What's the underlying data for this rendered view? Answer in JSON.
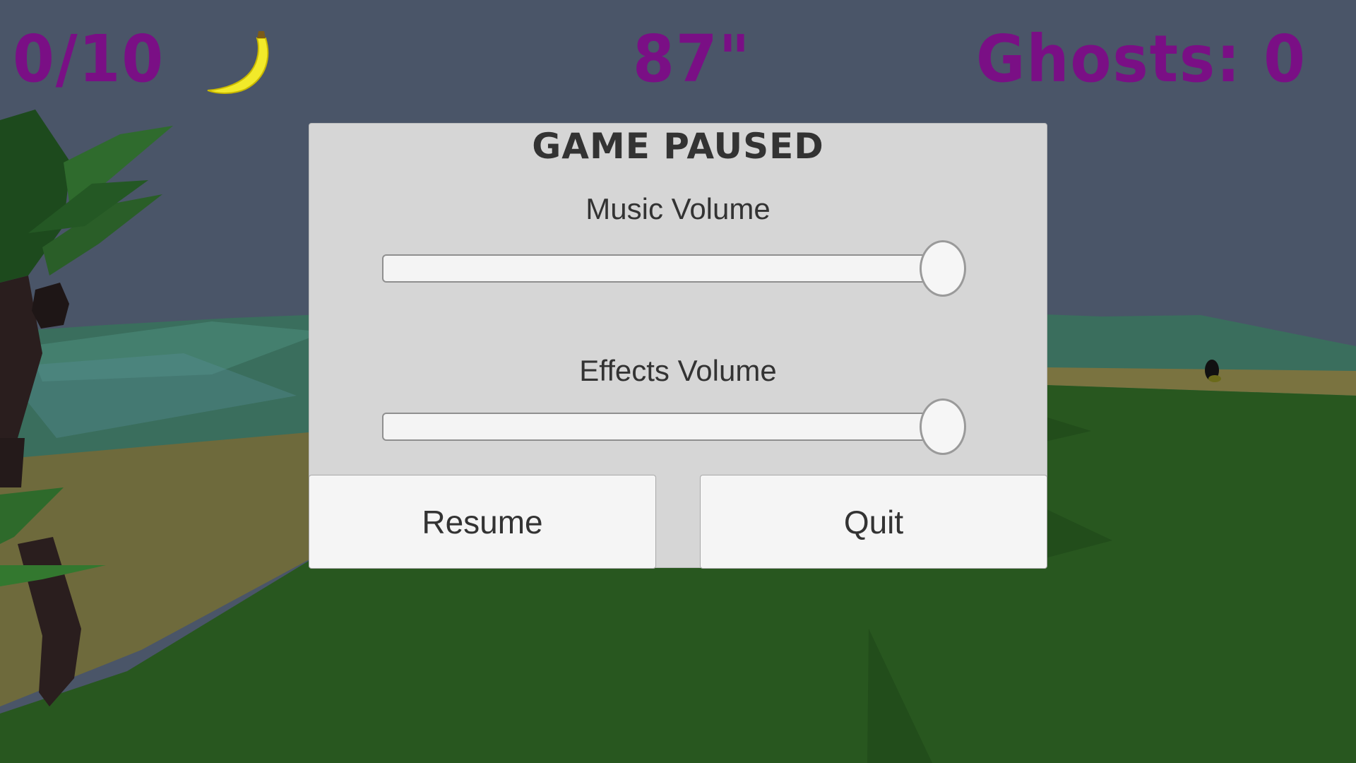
{
  "hud": {
    "banana_count": "0/10",
    "timer": "87\"",
    "ghosts": "Ghosts: 0",
    "banana_icon": "banana-icon",
    "text_color": "#7a0f85"
  },
  "pause_menu": {
    "title": "GAME PAUSED",
    "music": {
      "label": "Music Volume",
      "value": 1.0
    },
    "effects": {
      "label": "Effects Volume",
      "value": 1.0
    },
    "resume_label": "Resume",
    "quit_label": "Quit"
  },
  "colors": {
    "sky": "#4a5568",
    "grass": "#28571f",
    "sand": "#6e6a3c",
    "sea": "#3a6e5d",
    "panel": "#d6d6d6"
  }
}
